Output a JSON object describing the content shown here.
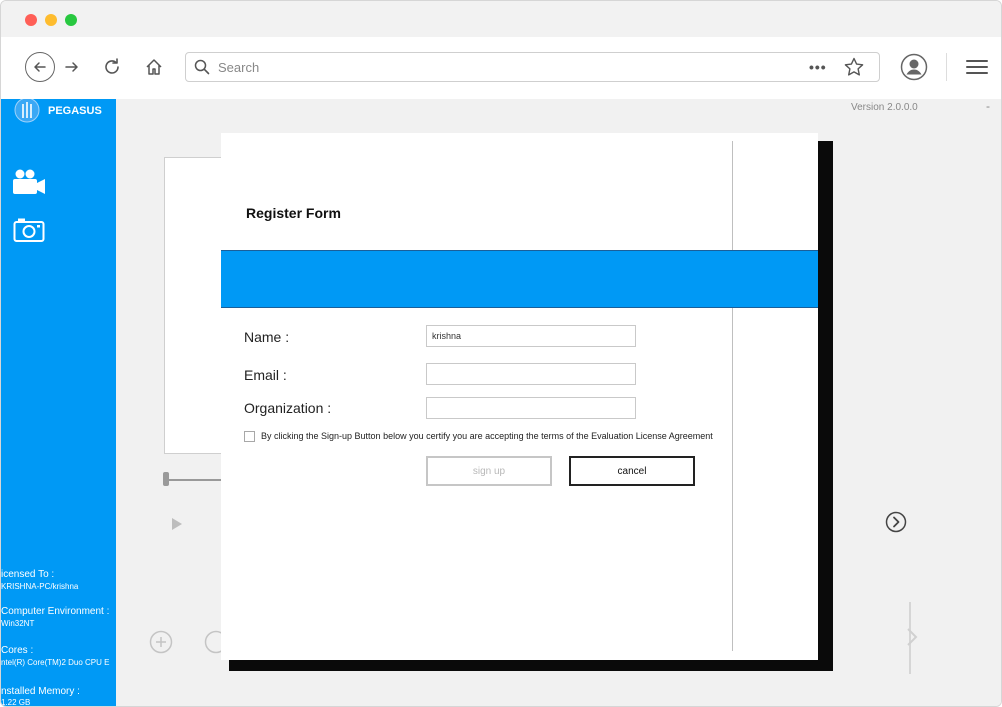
{
  "window": {
    "controls": [
      "close",
      "minimize",
      "maximize"
    ]
  },
  "browser": {
    "search": {
      "placeholder": "Search",
      "more_label": "•••"
    },
    "icons": [
      "back-icon",
      "forward-icon",
      "reload-icon",
      "home-icon",
      "search-icon",
      "bookmark-star-icon",
      "profile-icon",
      "menu-icon"
    ]
  },
  "app": {
    "name": "PEGASUS",
    "version": "Version 2.0.0.0",
    "version_dash": "-",
    "sidebar": {
      "nav_icons": [
        "video-camera-icon",
        "photo-camera-icon"
      ],
      "info": [
        {
          "label": "icensed To :",
          "value": "KRISHNA-PC/krishna"
        },
        {
          "label": "Computer Environment :",
          "value": "Win32NT"
        },
        {
          "label": "Cores :",
          "value": "ntel(R) Core(TM)2 Duo CPU     E"
        },
        {
          "label": "nstalled Memory :",
          "value": "1.22 GB"
        }
      ]
    },
    "colors": {
      "accent": "#0099f5",
      "band_border": "#1a5f9a"
    }
  },
  "register_form": {
    "title": "Register Form",
    "fields": [
      {
        "label": "Name :",
        "value": "krishna",
        "placeholder": ""
      },
      {
        "label": "Email :",
        "value": "",
        "placeholder": ""
      },
      {
        "label": "Organization :",
        "value": "",
        "placeholder": ""
      }
    ],
    "terms": {
      "checked": false,
      "text": "By clicking the Sign-up Button below you certify you are accepting the terms of the Evaluation License Agreement"
    },
    "buttons": {
      "signup": "sign up",
      "cancel": "cancel"
    }
  }
}
